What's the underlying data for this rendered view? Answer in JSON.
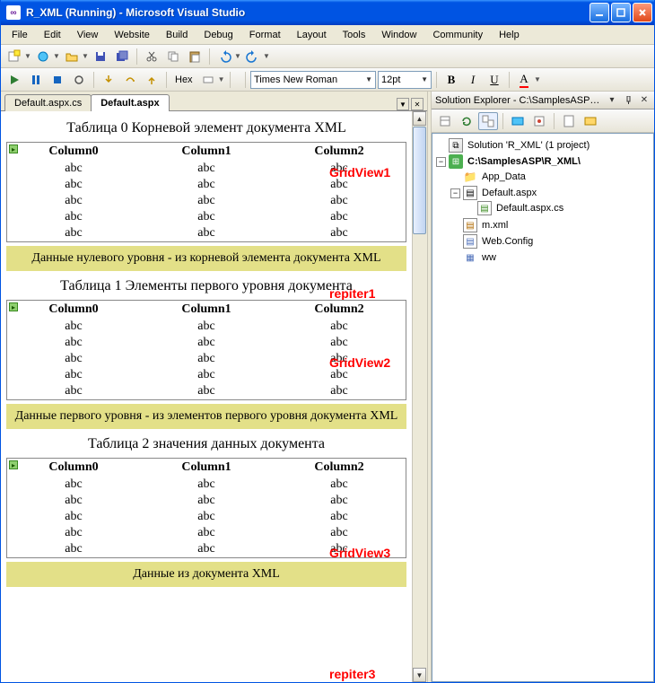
{
  "window": {
    "title": "R_XML (Running) - Microsoft Visual Studio",
    "icon_glyph": "∞"
  },
  "menu": [
    "File",
    "Edit",
    "View",
    "Website",
    "Build",
    "Debug",
    "Format",
    "Layout",
    "Tools",
    "Window",
    "Community",
    "Help"
  ],
  "toolbar2": {
    "hex_label": "Hex",
    "font_combo": "Times New Roman",
    "size_combo": "12pt"
  },
  "tabs": {
    "items": [
      "Default.aspx.cs",
      "Default.aspx"
    ],
    "active_index": 1
  },
  "designer": {
    "group1": {
      "title": "Таблица 0 Корневой элемент документа XML",
      "cols": [
        "Column0",
        "Column1",
        "Column2"
      ],
      "cell": "abc",
      "rows": 5,
      "repeater": "Данные нулевого уровня - из корневой элемента документа XML",
      "annot_grid": "GridView1",
      "annot_rep": "repiter1"
    },
    "group2": {
      "title": "Таблица 1 Элементы первого уровня документа",
      "cols": [
        "Column0",
        "Column1",
        "Column2"
      ],
      "cell": "abc",
      "rows": 5,
      "repeater": "Данные первого уровня - из элементов первого уровня документа XML",
      "annot_grid": "GridView2",
      "annot_rep": "repiter2"
    },
    "group3": {
      "title": "Таблица 2 значения данных документа",
      "cols": [
        "Column0",
        "Column1",
        "Column2"
      ],
      "cell": "abc",
      "rows": 5,
      "repeater": "Данные из документа XML",
      "annot_grid": "GridView3",
      "annot_rep": "repiter3"
    }
  },
  "solution_explorer": {
    "title": "Solution Explorer - C:\\SamplesASP\\R...",
    "solution": "Solution 'R_XML' (1 project)",
    "project": "C:\\SamplesASP\\R_XML\\",
    "nodes": {
      "app_data": "App_Data",
      "default_aspx": "Default.aspx",
      "default_cs": "Default.aspx.cs",
      "m_xml": "m.xml",
      "web_config": "Web.Config",
      "ww": "ww"
    }
  }
}
